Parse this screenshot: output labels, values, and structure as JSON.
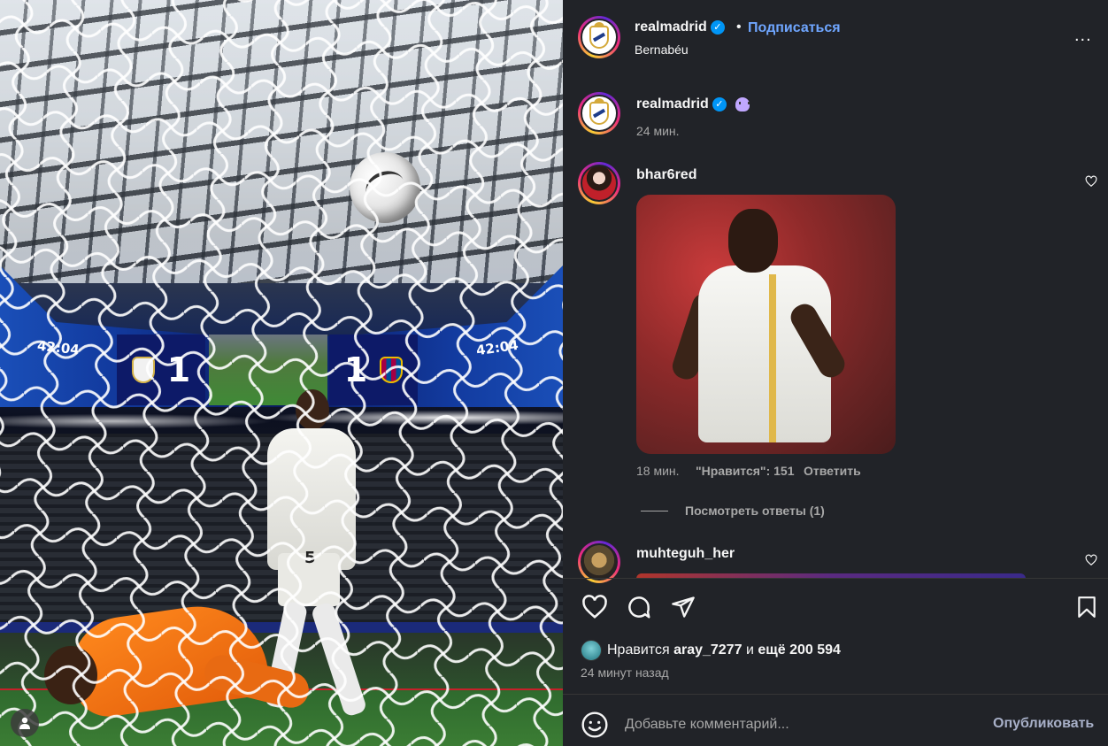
{
  "photo": {
    "scoreboard": {
      "time_left": "42:04",
      "time_right": "42:04",
      "home_score": "1",
      "away_score": "1"
    },
    "player_number": "5"
  },
  "post_header": {
    "username": "realmadrid",
    "separator": "•",
    "follow_label": "Подписаться",
    "location": "Bernabéu",
    "more_label": "..."
  },
  "caption": {
    "username": "realmadrid",
    "time": "24 мин."
  },
  "comments": [
    {
      "username": "bhar6red",
      "time": "18 мин.",
      "likes": "\"Нравится\": 151",
      "reply_label": "Ответить",
      "view_replies": "Посмотреть ответы (1)"
    },
    {
      "username": "muhteguh_her"
    }
  ],
  "likes": {
    "prefix": "Нравится",
    "user": "aray_7277",
    "middle": "и",
    "rest": "ещё 200 594"
  },
  "posted_ago": "24 минут назад",
  "comment_bar": {
    "placeholder": "Добавьте комментарий...",
    "publish_label": "Опубликовать"
  },
  "colors": {
    "panel_bg": "#212328",
    "link_blue": "#6fa6ff",
    "verified_blue": "#0095f6",
    "muted_text": "#a8a8a8"
  },
  "icons": [
    "heart-icon",
    "comment-icon",
    "share-icon",
    "bookmark-icon",
    "emoji-icon",
    "more-icon",
    "verified-icon",
    "user-icon"
  ]
}
